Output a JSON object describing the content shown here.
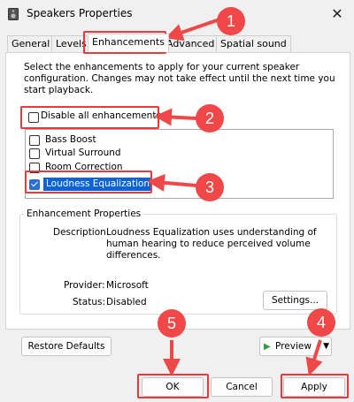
{
  "window": {
    "title": "Speakers Properties",
    "close_glyph": "✕"
  },
  "tabs": [
    {
      "label": "General",
      "active": false
    },
    {
      "label": "Levels",
      "active": false
    },
    {
      "label": "Enhancements",
      "active": true
    },
    {
      "label": "Advanced",
      "active": false
    },
    {
      "label": "Spatial sound",
      "active": false
    }
  ],
  "panel": {
    "description": "Select the enhancements to apply for your current speaker configuration. Changes may not take effect until the next time you start playback.",
    "disable_all": {
      "label": "Disable all enhancements",
      "checked": false
    },
    "enhancements": [
      {
        "label": "Bass Boost",
        "checked": false,
        "selected": false
      },
      {
        "label": "Virtual Surround",
        "checked": false,
        "selected": false
      },
      {
        "label": "Room Correction",
        "checked": false,
        "selected": false
      },
      {
        "label": "Loudness Equalization",
        "checked": true,
        "selected": true
      }
    ],
    "properties": {
      "title": "Enhancement Properties",
      "description_label": "Description:",
      "description_value": "Loudness Equalization uses understanding of human hearing to reduce perceived volume differences.",
      "provider_label": "Provider:",
      "provider_value": "Microsoft",
      "status_label": "Status:",
      "status_value": "Disabled",
      "settings_button": "Settings..."
    },
    "restore_defaults": "Restore Defaults",
    "preview": {
      "label": "Preview",
      "play_glyph": "▶",
      "dropdown_glyph": "▼"
    }
  },
  "footer": {
    "ok": "OK",
    "cancel": "Cancel",
    "apply": "Apply"
  },
  "annotations": {
    "callouts": [
      "1",
      "2",
      "3",
      "4",
      "5"
    ],
    "accent_color": "#f04848"
  }
}
